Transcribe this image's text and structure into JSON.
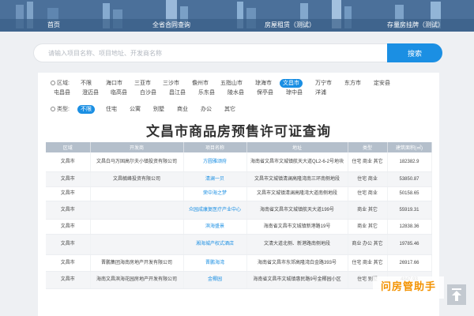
{
  "nav": {
    "home": "首页",
    "contract_search": "全省合同查询",
    "rent_listing": "房屋租赁（测试）",
    "existing_listing": "存量房挂牌（测试）"
  },
  "search": {
    "placeholder": "请输入项目名称、项目地址、开发商名称",
    "button": "搜索"
  },
  "filters": {
    "region_label": "区域:",
    "regions_row1": [
      "不限",
      "海口市",
      "三亚市",
      "三沙市",
      "儋州市",
      "五指山市",
      "琼海市",
      "文昌市",
      "万宁市",
      "东方市",
      "定安县"
    ],
    "regions_row2": [
      "屯昌县",
      "澄迈县",
      "临高县",
      "白沙县",
      "昌江县",
      "乐东县",
      "陵水县",
      "保亭县",
      "琼中县",
      "洋浦"
    ],
    "region_selected": "文昌市",
    "type_label": "类型:",
    "types": [
      "不限",
      "住宅",
      "公寓",
      "别墅",
      "商业",
      "办公",
      "其它"
    ],
    "type_selected": "不限"
  },
  "title": "文昌市商品房预售许可证查询",
  "table": {
    "headers": [
      "区域",
      "开发商",
      "项目名称",
      "地址",
      "类型",
      "建筑面积(㎡)"
    ],
    "rows": [
      [
        "文昌市",
        "文昌白马万固高尔夫小镇投资有限公司",
        "方圆雅颂府",
        "海南省文昌市文城镇航天大道QL2-6-2号地块",
        "住宅 商业 其它",
        "182382.9"
      ],
      [
        "文昌市",
        "文昌毓峰投资有限公司",
        "清澜一贝",
        "文昌市文城镇清澜高隆湾南三环南侧地段",
        "住宅 商业",
        "53850.87"
      ],
      [
        "文昌市",
        "",
        "荣中海之梦",
        "文昌市文城镇清澜高隆湾大道南侧地段",
        "住宅 商业",
        "50158.65"
      ],
      [
        "文昌市",
        "",
        "众园成康复医疗产业中心",
        "海南省文昌市文城镇航天大道199号",
        "商业 其它",
        "55919.31"
      ],
      [
        "文昌市",
        "",
        "滨海盛景",
        "海南省文昌市文城镇新港路19号",
        "商业 其它",
        "12838.36"
      ],
      [
        "文昌市",
        "",
        "湘海城产权式酒店",
        "文清大道北侧、新港路南侧地段",
        "商业 办公 其它",
        "19785.46"
      ],
      [
        "文昌市",
        "晋鹏集团海南房地产开发有限公司",
        "晋鹏海湾",
        "海南省文昌市东郊高隆湾白金路393号",
        "住宅 商业 其它",
        "26917.66"
      ],
      [
        "文昌市",
        "海南文昌滨海花园房地产开发有限公司",
        "金椰园",
        "海南省文昌市文城镇惠民路9号金椰园小区",
        "住宅 别墅",
        "4847.93"
      ]
    ]
  },
  "helper_text": "问房管助手"
}
